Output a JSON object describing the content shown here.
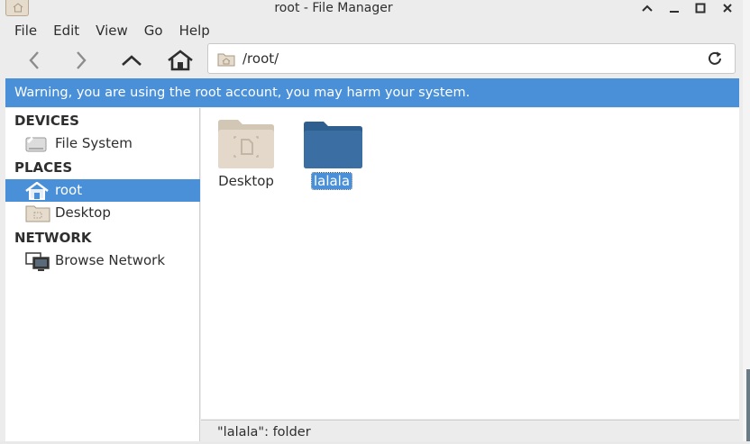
{
  "window": {
    "title": "root - File Manager"
  },
  "menubar": {
    "items": [
      "File",
      "Edit",
      "View",
      "Go",
      "Help"
    ]
  },
  "toolbar": {
    "back_icon": "back-arrow-icon",
    "forward_icon": "forward-arrow-icon",
    "up_icon": "up-arrow-icon",
    "home_icon": "home-icon",
    "location_path": "/root/",
    "reload_icon": "reload-icon"
  },
  "warning": {
    "text": "Warning, you are using the root account, you may harm your system."
  },
  "sidebar": {
    "sections": [
      {
        "heading": "DEVICES",
        "items": [
          {
            "label": "File System",
            "icon": "drive-icon",
            "selected": false
          }
        ]
      },
      {
        "heading": "PLACES",
        "items": [
          {
            "label": "root",
            "icon": "home-icon",
            "selected": true
          },
          {
            "label": "Desktop",
            "icon": "desktop-folder-icon",
            "selected": false
          }
        ]
      },
      {
        "heading": "NETWORK",
        "items": [
          {
            "label": "Browse Network",
            "icon": "network-icon",
            "selected": false
          }
        ]
      }
    ]
  },
  "files": [
    {
      "name": "Desktop",
      "icon": "desktop-folder-icon",
      "selected": false
    },
    {
      "name": "lalala",
      "icon": "folder-icon",
      "selected": true
    }
  ],
  "statusbar": {
    "text": "\"lalala\": folder"
  },
  "colors": {
    "accent": "#4a90d9",
    "folder_blue": "#3b6fa3",
    "folder_beige": "#dcd0c0"
  }
}
